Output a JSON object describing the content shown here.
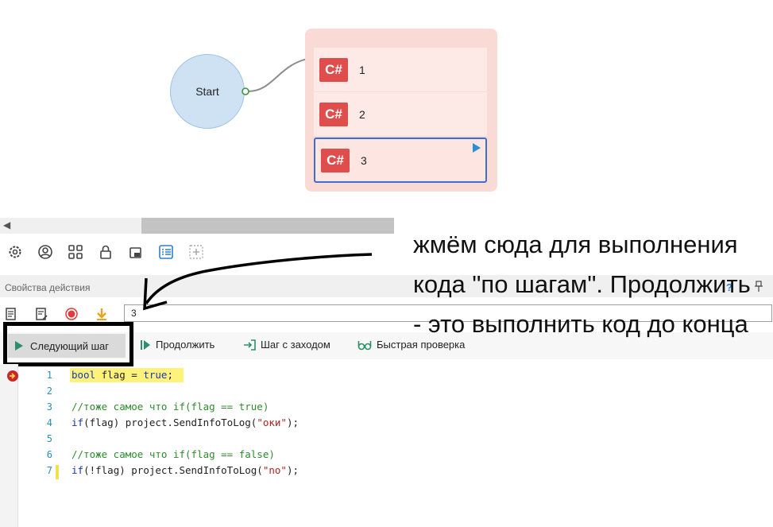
{
  "flow": {
    "start_label": "Start",
    "actions": [
      {
        "badge": "C#",
        "label": "1"
      },
      {
        "badge": "C#",
        "label": "2"
      },
      {
        "badge": "C#",
        "label": "3"
      }
    ]
  },
  "panel": {
    "title": "Свойства действия",
    "help": "?",
    "pin": "📌",
    "step_field_value": "3"
  },
  "debug_toolbar": {
    "next_step": "Следующий шаг",
    "continue": "Продолжить",
    "step_into": "Шаг с заходом",
    "quick_watch": "Быстрая проверка"
  },
  "code": {
    "line_numbers": [
      "1",
      "2",
      "3",
      "4",
      "5",
      "6",
      "7"
    ],
    "lines": [
      "bool flag = true;",
      "",
      "//тоже самое что if(flag == true)",
      "if(flag) project.SendInfoToLog(\"оки\");",
      "",
      "//тоже самое что if(flag == false)",
      "if(!flag) project.SendInfoToLog(\"no\");"
    ]
  },
  "annotation": {
    "text": "жмём сюда для выполнения кода \"по шагам\". Продолжить - это выполнить код до конца"
  },
  "colors": {
    "csharp_badge": "#e04d4d",
    "selection": "#3d6fcf",
    "breakpoint_highlight": "#fff27a",
    "comment": "#2e8b2e",
    "keyword": "#1a36b8",
    "string": "#b22222"
  }
}
